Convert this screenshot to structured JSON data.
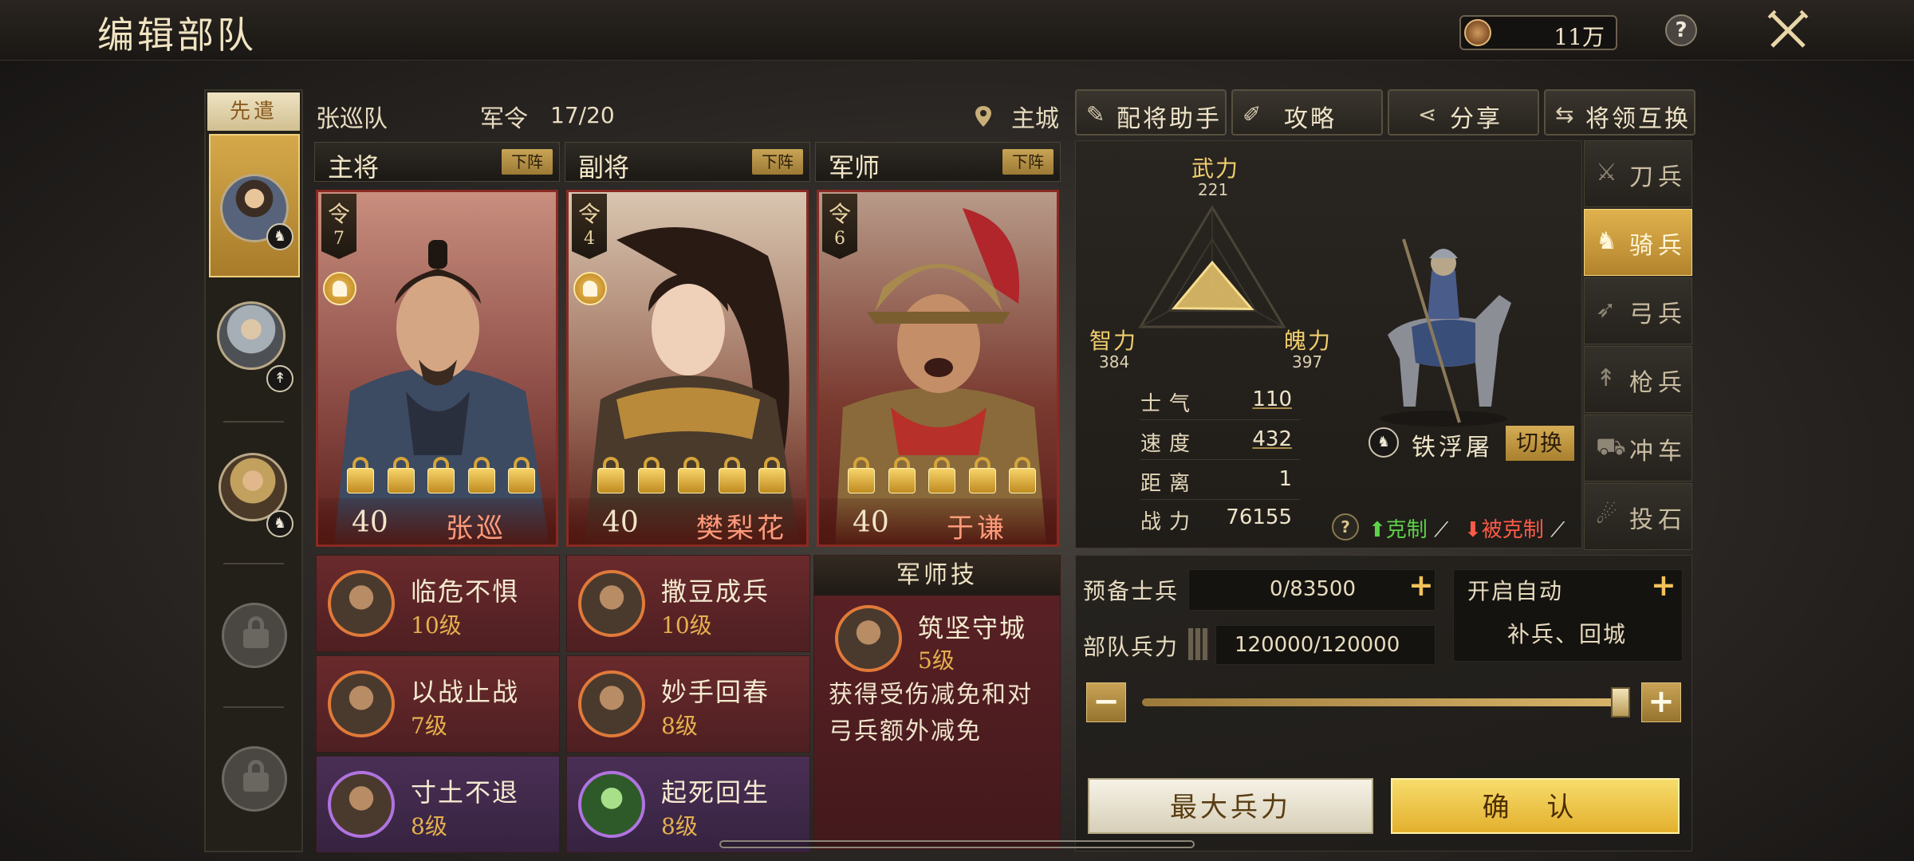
{
  "header": {
    "title": "编辑部队",
    "currency_value": "11万",
    "help_label": "?"
  },
  "left_column": {
    "vanguard_tab": "先遣"
  },
  "team": {
    "name": "张巡队",
    "order_label": "军令",
    "order_value": "17/20",
    "location": "主城"
  },
  "roles": [
    {
      "label": "主将",
      "demote": "下阵"
    },
    {
      "label": "副将",
      "demote": "下阵"
    },
    {
      "label": "军师",
      "demote": "下阵"
    }
  ],
  "generals": [
    {
      "ling": "令",
      "cost": "7",
      "level": "40",
      "name": "张巡"
    },
    {
      "ling": "令",
      "cost": "4",
      "level": "40",
      "name": "樊梨花"
    },
    {
      "ling": "令",
      "cost": "6",
      "level": "40",
      "name": "于谦"
    }
  ],
  "skills": [
    {
      "name": "临危不惧",
      "level": "10级"
    },
    {
      "name": "撒豆成兵",
      "level": "10级"
    },
    {
      "name": "以战止战",
      "level": "7级"
    },
    {
      "name": "妙手回春",
      "level": "8级"
    },
    {
      "name": "寸土不退",
      "level": "8级"
    },
    {
      "name": "起死回生",
      "level": "8级"
    }
  ],
  "advisor": {
    "title": "军师技",
    "skill_name": "筑坚守城",
    "skill_level": "5级",
    "description": "获得受伤减免和对弓兵额外减免"
  },
  "toolbar": {
    "assistant": "配将助手",
    "guide": "攻略",
    "share": "分享",
    "swap": "将领互换"
  },
  "attributes": {
    "force_label": "武力",
    "force_value": "221",
    "intel_label": "智力",
    "intel_value": "384",
    "charm_label": "魄力",
    "charm_value": "397",
    "radar_levels": [
      0.56,
      0.97,
      1.0
    ]
  },
  "stats": [
    {
      "label": "士气",
      "value": "110"
    },
    {
      "label": "速度",
      "value": "432"
    },
    {
      "label": "距离",
      "value": "1"
    },
    {
      "label": "战力",
      "value": "76155"
    }
  ],
  "unit": {
    "name": "铁浮屠",
    "switch_label": "切换",
    "counter_label": "克制",
    "countered_label": "被克制"
  },
  "troop_types": [
    {
      "label": "刀兵",
      "active": false
    },
    {
      "label": "骑兵",
      "active": true
    },
    {
      "label": "弓兵",
      "active": false
    },
    {
      "label": "枪兵",
      "active": false
    },
    {
      "label": "冲车",
      "active": false
    },
    {
      "label": "投石",
      "active": false
    }
  ],
  "reserve": {
    "label": "预备士兵",
    "value": "0/83500"
  },
  "auto": {
    "label": "开启自动",
    "value": "补兵、回城"
  },
  "strength": {
    "label": "部队兵力",
    "value": "120000/120000",
    "slider_fraction": 1.0
  },
  "actions": {
    "max_label": "最大兵力",
    "confirm_label": "确 认"
  },
  "colors": {
    "accent_gold": "#e3b02e",
    "card_red": "#8a2a22",
    "counter_green": "#5fd04a",
    "countered_red": "#ff5a48"
  }
}
